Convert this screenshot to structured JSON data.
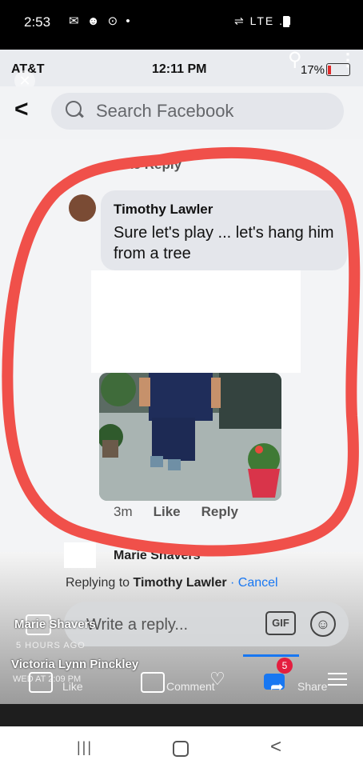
{
  "outer_status": {
    "time": "2:53",
    "icons_left": "✉ ☻ ⊙ •",
    "network": "⇌ LTE .ıl"
  },
  "inner_status": {
    "carrier": "AT&T",
    "time": "12:11 PM",
    "battery": "17%"
  },
  "header": {
    "search_placeholder": "Search Facebook"
  },
  "previous_comment": {
    "actions": "Like    Reply"
  },
  "comment": {
    "author": "Timothy Lawler",
    "text": "Sure let's play ... let's hang him from a tree",
    "time": "3m",
    "like": "Like",
    "reply": "Reply"
  },
  "next_comment": {
    "author": "Marie Shavers"
  },
  "reply_bar": {
    "replying_prefix": "Replying to",
    "replying_name": "Timothy Lawler",
    "cancel": "· Cancel",
    "placeholder": "Write a reply...",
    "gif": "GIF"
  },
  "overlay": {
    "name1": "Marie Shavers",
    "time1": "5 HOURS AGO",
    "name2": "Victoria Lynn Pinckley",
    "time2": "WED AT 2:09 PM",
    "like": "Like",
    "comment": "Comment",
    "share": "Share",
    "badge": "5"
  },
  "colors": {
    "annotation_red": "#f0504a",
    "facebook_blue": "#1877f2"
  }
}
